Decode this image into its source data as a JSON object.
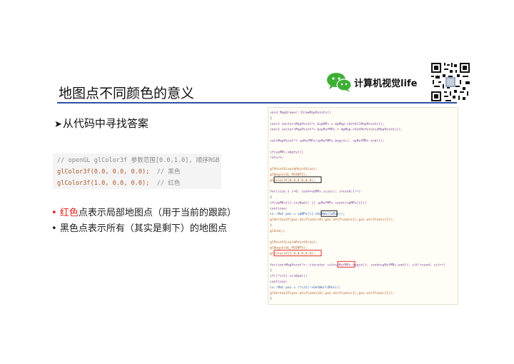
{
  "brand": {
    "name": "计算机视觉life",
    "logo_icon": "wechat-icon",
    "qr_icon": "qr-code-icon"
  },
  "slide": {
    "title": "地图点不同颜色的意义",
    "subhead_arrow": "➤",
    "subhead": "从代码中寻找答案"
  },
  "code": {
    "line1": "// openGL glColor3f 参数范围[0.0,1.0], 顺序RGB",
    "line2_fn": "glColor3f(0.0, 0.0, 0.0);",
    "line2_cm": "  // 黑色",
    "line3_fn": "glColor3f(1.0, 0.0, 0.0);",
    "line3_cm": "  // 红色"
  },
  "bullets": [
    {
      "marker": "•",
      "highlight": "红色",
      "text": "点表示局部地图点（用于当前的跟踪）"
    },
    {
      "marker": "•",
      "text": "黑色点表示所有（其实是剩下）的地图点"
    }
  ],
  "source_screenshot": {
    "lines": [
      "void MapDrawer::DrawMapPoints()",
      "{",
      "    const vector<MapPoint*> &vpMPs = mpMap->GetAllMapPoints();",
      "    const vector<MapPoint*> &vpRefMPs = mpMap->GetReferenceMapPoints();",
      "",
      "    set<MapPoint*> spRefMPs(vpRefMPs.begin(), vpRefMPs.end());",
      "",
      "    if(vpMPs.empty())",
      "        return;",
      "",
      "    glPointSize(mPointSize);",
      "    glBegin(GL_POINTS);",
      "    glColor3f(0.0,0.0,0.0);",
      "",
      "    for(size_t i=0, iend=vpMPs.size(); i<iend;i++)",
      "    {",
      "        if(vpMPs[i]->isBad() || spRefMPs.count(vpMPs[i]))",
      "            continue;",
      "        cv::Mat pos = vpMPs[i]->GetWorldPos();",
      "        glVertex3f(pos.at<float>(0),pos.at<float>(1),pos.at<float>(2));",
      "    }",
      "    glEnd();",
      "",
      "    glPointSize(mPointSize);",
      "    glBegin(GL_POINTS);",
      "    glColor3f(1.0,0.0,0.0);",
      "",
      "    for(set<MapPoint*>::iterator sit=spRefMPs.begin(), send=spRefMPs.end(); sit!=send; sit++)",
      "    {",
      "        if((*sit)->isBad())",
      "            continue;",
      "        cv::Mat pos = (*sit)->GetWorldPos();",
      "        glVertex3f(pos.at<float>(0),pos.at<float>(1),pos.at<float>(2));",
      "    }"
    ]
  },
  "colors": {
    "accent_rule": "#2b4fa8",
    "red": "#e02020",
    "box_black": "#000000",
    "box_red": "#e02020",
    "code_keyword": "#7a3e9d",
    "code_func": "#b05a2b",
    "code_type": "#2c5fb0"
  }
}
